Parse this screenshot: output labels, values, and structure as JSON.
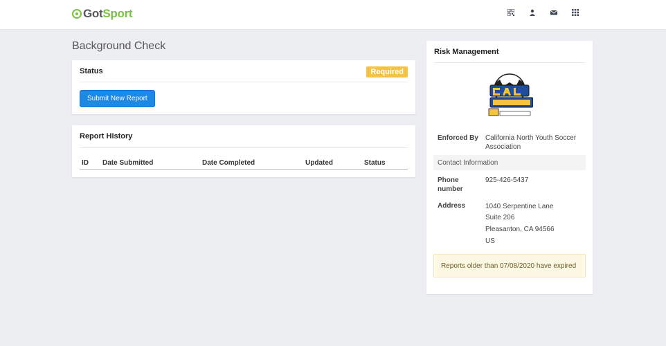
{
  "brand": {
    "name_part1": "Got",
    "name_part2": "Sport"
  },
  "header_icons": [
    "qr-icon",
    "user-icon",
    "envelope-icon",
    "grid-icon"
  ],
  "page": {
    "title": "Background Check"
  },
  "status_card": {
    "title": "Status",
    "badge": "Required",
    "submit_button": "Submit New Report"
  },
  "history_card": {
    "title": "Report History",
    "columns": [
      "ID",
      "Date Submitted",
      "Date Completed",
      "Updated",
      "Status"
    ]
  },
  "risk_management": {
    "title": "Risk Management",
    "enforced_by_label": "Enforced By",
    "enforced_by_value_line1": "California North Youth Soccer",
    "enforced_by_value_line2": "Association",
    "contact_header": "Contact Information",
    "phone_label_line1": "Phone",
    "phone_label_line2": "number",
    "phone_value": "925-426-5437",
    "address_label": "Address",
    "address_lines": [
      "1040 Serpentine Lane",
      "Suite 206",
      "Pleasanton, CA 94566",
      "US"
    ],
    "notice": "Reports older than 07/08/2020 have expired"
  },
  "colors": {
    "brand_green": "#7ac143",
    "primary": "#1e88e5",
    "warning": "#f5c242"
  }
}
